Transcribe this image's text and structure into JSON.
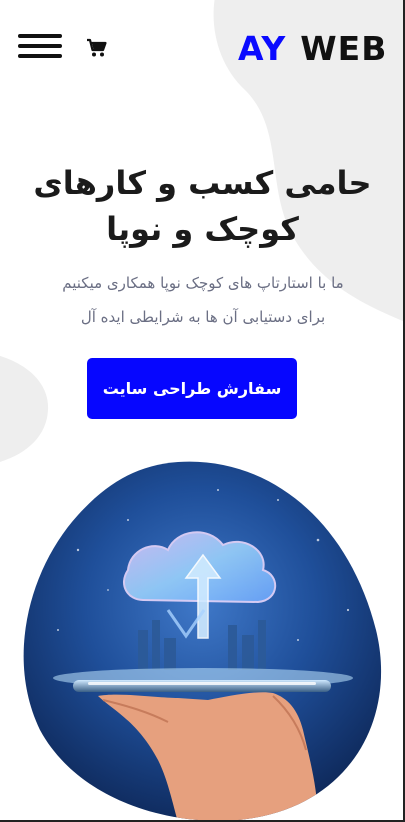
{
  "brand": {
    "logo_part1": "AY",
    "logo_part2": "WEB",
    "accent_color": "#0606ff"
  },
  "header": {
    "menu_icon": "hamburger-menu-icon",
    "cart_icon": "shopping-cart-icon"
  },
  "hero": {
    "title_line1": "حامی کسب و کارهای",
    "title_line2": "کوچک و نوپا",
    "subtitle_line1": "ما با استارتاپ های کوچک نوپا همکاری میکنیم",
    "subtitle_line2": "برای دستیابی آن ها به شرایطی ایده آل",
    "cta_label": "سفارش طراحی سایت",
    "image_subject": "hand-holding-phone-cloud-upload-image"
  }
}
